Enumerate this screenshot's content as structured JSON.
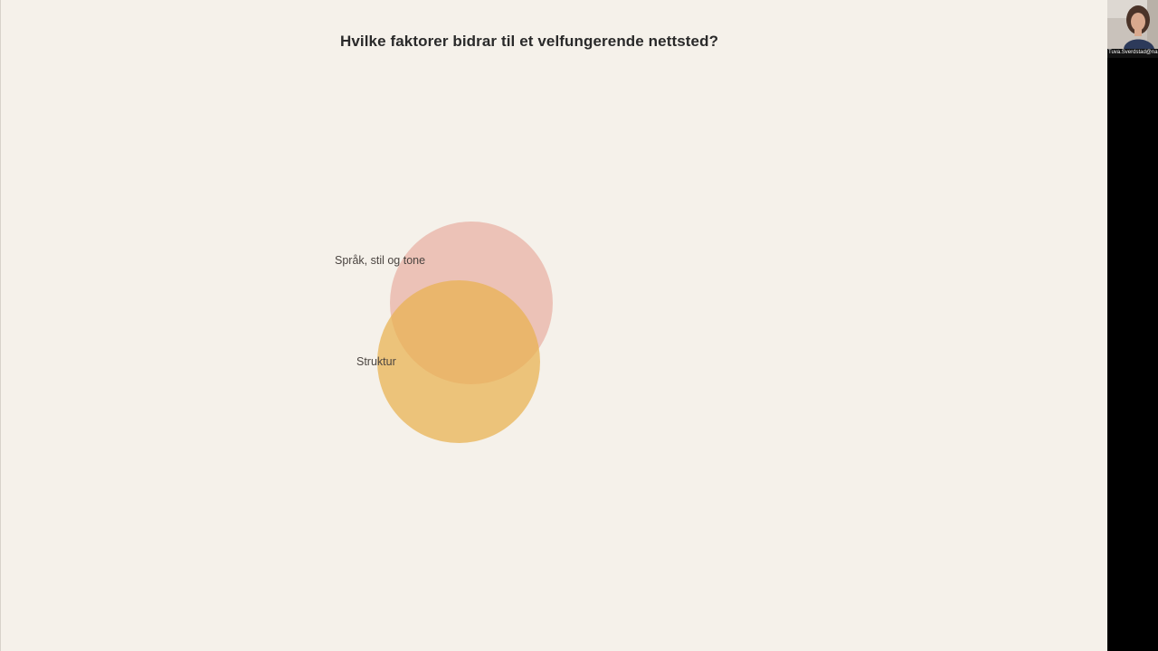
{
  "slide": {
    "title": "Hvilke faktorer bidrar til et velfungerende nettsted?",
    "background_color": "#f5f1ea"
  },
  "venn": {
    "sets": [
      {
        "label": "Språk, stil og tone",
        "color": "#e8b1a6",
        "opacity": 0.75
      },
      {
        "label": "Struktur",
        "color": "#e9b24f",
        "opacity": 0.72
      }
    ]
  },
  "participant": {
    "name": "Tuva.Sverdstad@na",
    "video_icon": "person-video-feed"
  }
}
